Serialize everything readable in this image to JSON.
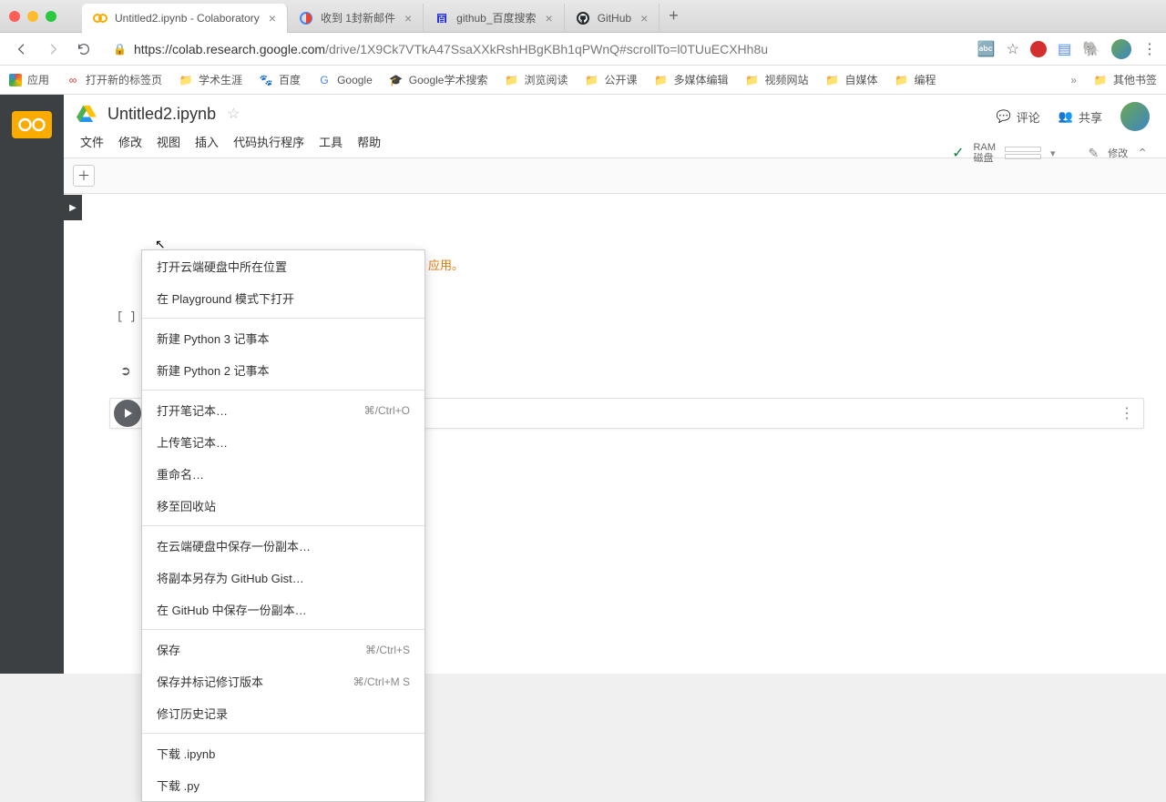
{
  "browser": {
    "tabs": [
      {
        "title": "Untitled2.ipynb - Colaboratory",
        "active": true
      },
      {
        "title": "收到 1封新邮件",
        "active": false
      },
      {
        "title": "github_百度搜索",
        "active": false
      },
      {
        "title": "GitHub",
        "active": false
      }
    ],
    "url_host": "https://colab.research.google.com",
    "url_path": "/drive/1X9Ck7VTkA47SsaXXkRshHBgKBh1qPWnQ#scrollTo=l0TUuECXHh8u"
  },
  "bookmarks": {
    "apps": "应用",
    "items": [
      {
        "label": "打开新的标签页"
      },
      {
        "label": "学术生涯"
      },
      {
        "label": "百度"
      },
      {
        "label": "Google"
      },
      {
        "label": "Google学术搜索"
      },
      {
        "label": "浏览阅读"
      },
      {
        "label": "公开课"
      },
      {
        "label": "多媒体编辑"
      },
      {
        "label": "视频网站"
      },
      {
        "label": "自媒体"
      },
      {
        "label": "编程"
      }
    ],
    "other": "其他书签"
  },
  "doc": {
    "title": "Untitled2.ipynb",
    "menus": [
      "文件",
      "修改",
      "视图",
      "插入",
      "代码执行程序",
      "工具",
      "帮助"
    ]
  },
  "header_right": {
    "comment": "评论",
    "share": "共享",
    "ram": "RAM",
    "disk": "磁盘",
    "edit": "修改"
  },
  "notebook": {
    "orange_text": "应用。",
    "cell_in": "[ ]",
    "cell_out": "➲"
  },
  "file_menu": [
    {
      "label": "打开云端硬盘中所在位置"
    },
    {
      "label": "在 Playground 模式下打开"
    },
    {
      "sep": true
    },
    {
      "label": "新建 Python 3 记事本"
    },
    {
      "label": "新建 Python 2 记事本"
    },
    {
      "sep": true
    },
    {
      "label": "打开笔记本…",
      "shortcut": "⌘/Ctrl+O"
    },
    {
      "label": "上传笔记本…"
    },
    {
      "label": "重命名…"
    },
    {
      "label": "移至回收站"
    },
    {
      "sep": true
    },
    {
      "label": "在云端硬盘中保存一份副本…"
    },
    {
      "label": "将副本另存为 GitHub Gist…"
    },
    {
      "label": "在 GitHub 中保存一份副本…"
    },
    {
      "sep": true
    },
    {
      "label": "保存",
      "shortcut": "⌘/Ctrl+S"
    },
    {
      "label": "保存并标记修订版本",
      "shortcut": "⌘/Ctrl+M S"
    },
    {
      "label": "修订历史记录"
    },
    {
      "sep": true
    },
    {
      "label": "下载 .ipynb"
    },
    {
      "label": "下载 .py"
    }
  ]
}
